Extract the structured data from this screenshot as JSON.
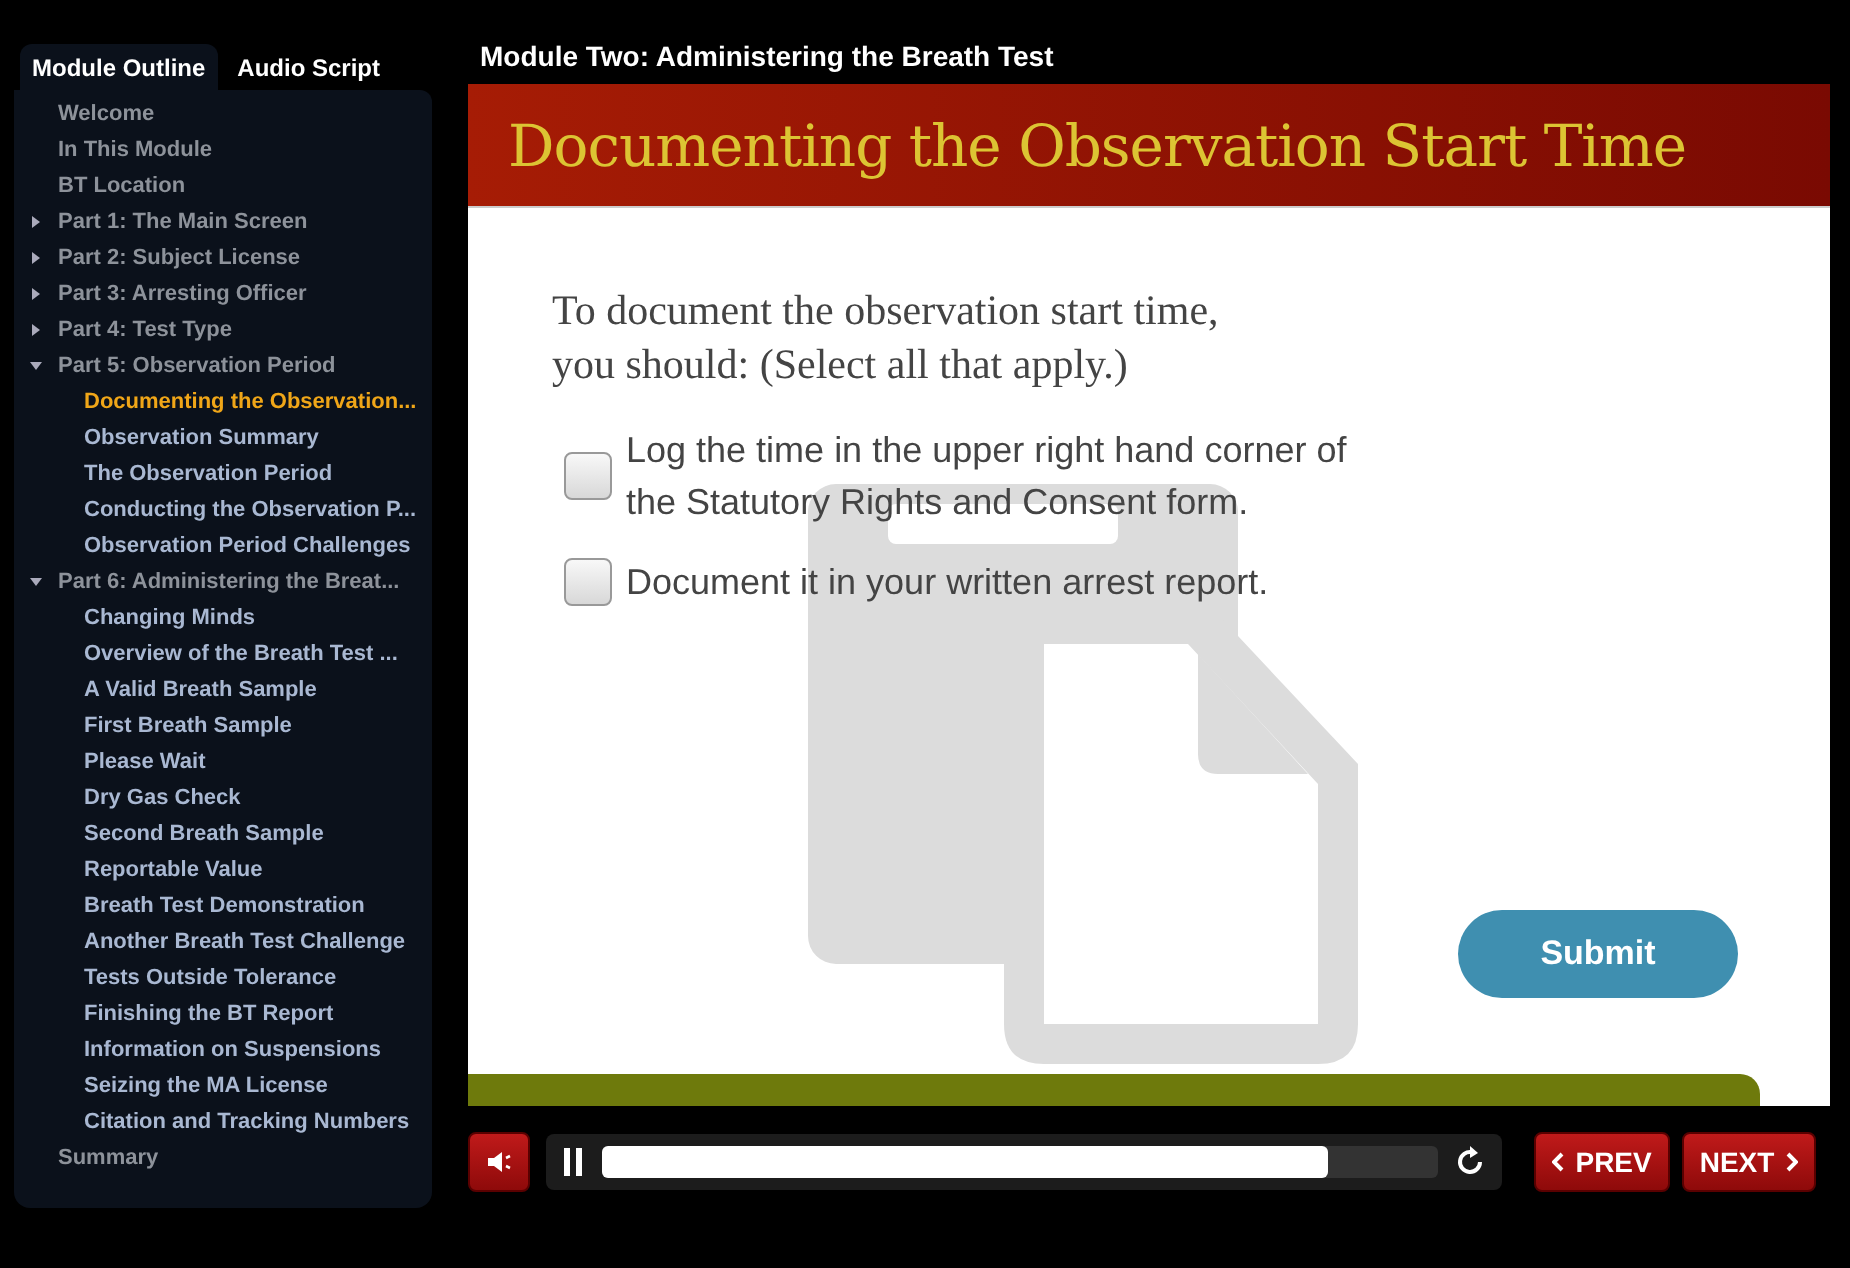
{
  "sidebar": {
    "tabs": [
      {
        "label": "Module Outline",
        "selected": true
      },
      {
        "label": "Audio Script",
        "selected": false
      }
    ],
    "items": [
      {
        "label": "Welcome",
        "selected": false
      },
      {
        "label": "In This Module",
        "selected": false
      },
      {
        "label": "BT Location",
        "selected": false
      },
      {
        "label": "Part 1: The Main Screen",
        "selected": false,
        "expanded": false
      },
      {
        "label": "Part 2: Subject License",
        "selected": false,
        "expanded": false
      },
      {
        "label": "Part 3: Arresting Officer",
        "selected": false,
        "expanded": false
      },
      {
        "label": "Part 4: Test Type",
        "selected": false,
        "expanded": false
      },
      {
        "label": "Part 5: Observation Period",
        "selected": false,
        "expanded": true,
        "children": [
          {
            "label": "Documenting the Observation...",
            "selected": true
          },
          {
            "label": "Observation Summary",
            "selected": false
          },
          {
            "label": "The Observation Period",
            "selected": false
          },
          {
            "label": "Conducting the Observation P...",
            "selected": false
          },
          {
            "label": "Observation Period Challenges",
            "selected": false
          }
        ]
      },
      {
        "label": "Part 6: Administering the Breat...",
        "selected": false,
        "expanded": true,
        "children": [
          {
            "label": "Changing Minds",
            "selected": false
          },
          {
            "label": "Overview of the Breath Test ...",
            "selected": false
          },
          {
            "label": "A Valid Breath Sample",
            "selected": false
          },
          {
            "label": "First Breath Sample",
            "selected": false
          },
          {
            "label": "Please Wait",
            "selected": false
          },
          {
            "label": "Dry Gas Check",
            "selected": false
          },
          {
            "label": "Second Breath Sample",
            "selected": false
          },
          {
            "label": "Reportable Value",
            "selected": false
          },
          {
            "label": "Breath Test Demonstration",
            "selected": false
          },
          {
            "label": "Another Breath Test Challenge",
            "selected": false
          },
          {
            "label": "Tests Outside Tolerance",
            "selected": false
          },
          {
            "label": "Finishing the BT Report",
            "selected": false
          },
          {
            "label": "Information on Suspensions",
            "selected": false
          },
          {
            "label": "Seizing the MA License",
            "selected": false
          },
          {
            "label": "Citation and Tracking Numbers",
            "selected": false
          }
        ]
      },
      {
        "label": "Summary",
        "selected": false
      }
    ]
  },
  "module_title": "Module Two: Administering the Breath Test",
  "slide": {
    "title": "Documenting the Observation Start Time",
    "question": "To document the observation start time,\nyou should: (Select all that apply.)",
    "options": [
      {
        "label": "Log the time in the upper right hand corner of\nthe Statutory Rights and Consent form.",
        "checked": false
      },
      {
        "label": "Document it in your written arrest report.",
        "checked": false
      }
    ],
    "submit": "Submit"
  },
  "player": {
    "progress": {
      "level": 0.87
    },
    "prev": "PREV",
    "next": "NEXT"
  }
}
